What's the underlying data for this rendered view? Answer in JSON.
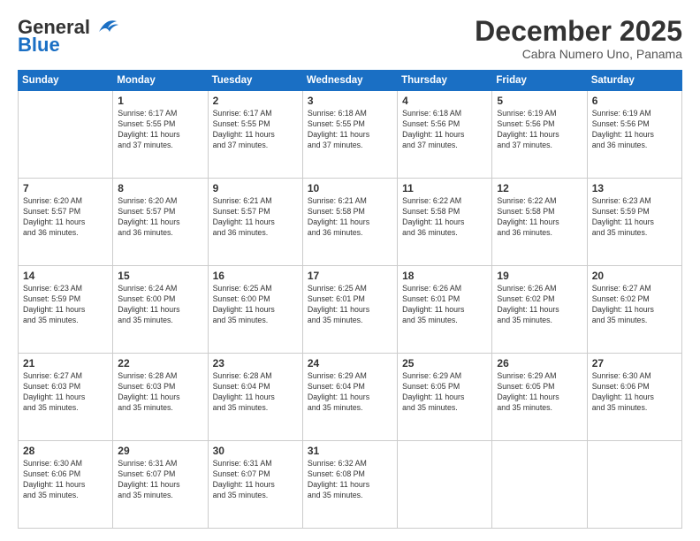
{
  "header": {
    "logo_general": "General",
    "logo_blue": "Blue",
    "month_title": "December 2025",
    "subtitle": "Cabra Numero Uno, Panama"
  },
  "days_of_week": [
    "Sunday",
    "Monday",
    "Tuesday",
    "Wednesday",
    "Thursday",
    "Friday",
    "Saturday"
  ],
  "weeks": [
    [
      {
        "day": "",
        "info": ""
      },
      {
        "day": "1",
        "info": "Sunrise: 6:17 AM\nSunset: 5:55 PM\nDaylight: 11 hours\nand 37 minutes."
      },
      {
        "day": "2",
        "info": "Sunrise: 6:17 AM\nSunset: 5:55 PM\nDaylight: 11 hours\nand 37 minutes."
      },
      {
        "day": "3",
        "info": "Sunrise: 6:18 AM\nSunset: 5:55 PM\nDaylight: 11 hours\nand 37 minutes."
      },
      {
        "day": "4",
        "info": "Sunrise: 6:18 AM\nSunset: 5:56 PM\nDaylight: 11 hours\nand 37 minutes."
      },
      {
        "day": "5",
        "info": "Sunrise: 6:19 AM\nSunset: 5:56 PM\nDaylight: 11 hours\nand 37 minutes."
      },
      {
        "day": "6",
        "info": "Sunrise: 6:19 AM\nSunset: 5:56 PM\nDaylight: 11 hours\nand 36 minutes."
      }
    ],
    [
      {
        "day": "7",
        "info": "Sunrise: 6:20 AM\nSunset: 5:57 PM\nDaylight: 11 hours\nand 36 minutes."
      },
      {
        "day": "8",
        "info": "Sunrise: 6:20 AM\nSunset: 5:57 PM\nDaylight: 11 hours\nand 36 minutes."
      },
      {
        "day": "9",
        "info": "Sunrise: 6:21 AM\nSunset: 5:57 PM\nDaylight: 11 hours\nand 36 minutes."
      },
      {
        "day": "10",
        "info": "Sunrise: 6:21 AM\nSunset: 5:58 PM\nDaylight: 11 hours\nand 36 minutes."
      },
      {
        "day": "11",
        "info": "Sunrise: 6:22 AM\nSunset: 5:58 PM\nDaylight: 11 hours\nand 36 minutes."
      },
      {
        "day": "12",
        "info": "Sunrise: 6:22 AM\nSunset: 5:58 PM\nDaylight: 11 hours\nand 36 minutes."
      },
      {
        "day": "13",
        "info": "Sunrise: 6:23 AM\nSunset: 5:59 PM\nDaylight: 11 hours\nand 35 minutes."
      }
    ],
    [
      {
        "day": "14",
        "info": "Sunrise: 6:23 AM\nSunset: 5:59 PM\nDaylight: 11 hours\nand 35 minutes."
      },
      {
        "day": "15",
        "info": "Sunrise: 6:24 AM\nSunset: 6:00 PM\nDaylight: 11 hours\nand 35 minutes."
      },
      {
        "day": "16",
        "info": "Sunrise: 6:25 AM\nSunset: 6:00 PM\nDaylight: 11 hours\nand 35 minutes."
      },
      {
        "day": "17",
        "info": "Sunrise: 6:25 AM\nSunset: 6:01 PM\nDaylight: 11 hours\nand 35 minutes."
      },
      {
        "day": "18",
        "info": "Sunrise: 6:26 AM\nSunset: 6:01 PM\nDaylight: 11 hours\nand 35 minutes."
      },
      {
        "day": "19",
        "info": "Sunrise: 6:26 AM\nSunset: 6:02 PM\nDaylight: 11 hours\nand 35 minutes."
      },
      {
        "day": "20",
        "info": "Sunrise: 6:27 AM\nSunset: 6:02 PM\nDaylight: 11 hours\nand 35 minutes."
      }
    ],
    [
      {
        "day": "21",
        "info": "Sunrise: 6:27 AM\nSunset: 6:03 PM\nDaylight: 11 hours\nand 35 minutes."
      },
      {
        "day": "22",
        "info": "Sunrise: 6:28 AM\nSunset: 6:03 PM\nDaylight: 11 hours\nand 35 minutes."
      },
      {
        "day": "23",
        "info": "Sunrise: 6:28 AM\nSunset: 6:04 PM\nDaylight: 11 hours\nand 35 minutes."
      },
      {
        "day": "24",
        "info": "Sunrise: 6:29 AM\nSunset: 6:04 PM\nDaylight: 11 hours\nand 35 minutes."
      },
      {
        "day": "25",
        "info": "Sunrise: 6:29 AM\nSunset: 6:05 PM\nDaylight: 11 hours\nand 35 minutes."
      },
      {
        "day": "26",
        "info": "Sunrise: 6:29 AM\nSunset: 6:05 PM\nDaylight: 11 hours\nand 35 minutes."
      },
      {
        "day": "27",
        "info": "Sunrise: 6:30 AM\nSunset: 6:06 PM\nDaylight: 11 hours\nand 35 minutes."
      }
    ],
    [
      {
        "day": "28",
        "info": "Sunrise: 6:30 AM\nSunset: 6:06 PM\nDaylight: 11 hours\nand 35 minutes."
      },
      {
        "day": "29",
        "info": "Sunrise: 6:31 AM\nSunset: 6:07 PM\nDaylight: 11 hours\nand 35 minutes."
      },
      {
        "day": "30",
        "info": "Sunrise: 6:31 AM\nSunset: 6:07 PM\nDaylight: 11 hours\nand 35 minutes."
      },
      {
        "day": "31",
        "info": "Sunrise: 6:32 AM\nSunset: 6:08 PM\nDaylight: 11 hours\nand 35 minutes."
      },
      {
        "day": "",
        "info": ""
      },
      {
        "day": "",
        "info": ""
      },
      {
        "day": "",
        "info": ""
      }
    ]
  ]
}
